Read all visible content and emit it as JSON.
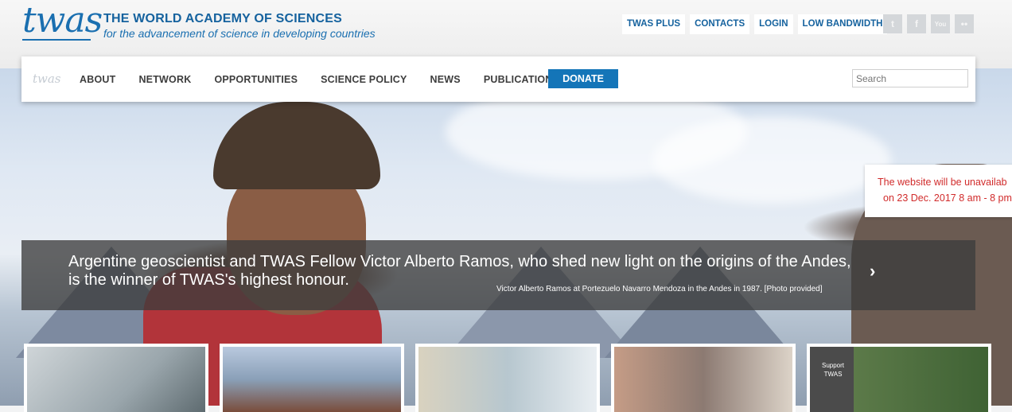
{
  "header": {
    "logo_text": "twas",
    "org_title": "THE WORLD ACADEMY OF SCIENCES",
    "org_subtitle": "for the advancement of science in developing countries",
    "top_links": [
      "TWAS PLUS",
      "CONTACTS",
      "LOGIN",
      "LOW BANDWIDTH"
    ],
    "social_icons": [
      "twitter-icon",
      "facebook-icon",
      "youtube-icon",
      "flickr-icon"
    ],
    "social_glyphs": [
      "t",
      "f",
      "You",
      "••"
    ]
  },
  "nav": {
    "logo_text": "twas",
    "items": [
      "ABOUT",
      "NETWORK",
      "OPPORTUNITIES",
      "SCIENCE POLICY",
      "NEWS",
      "PUBLICATIONS"
    ],
    "donate_label": "DONATE",
    "search_placeholder": "Search"
  },
  "notice": {
    "line1": "The website will be unavailab",
    "line2": "on 23 Dec. 2017 8 am - 8 pm",
    "color": "#d12b2b"
  },
  "hero": {
    "headline": "Argentine geoscientist and TWAS Fellow Victor Alberto Ramos, who shed new light on the origins of the Andes, is the winner of TWAS's highest honour.",
    "credit": "Victor Alberto Ramos at Portezuelo Navarro Mendoza in the Andes in 1987. [Photo provided]",
    "next_icon": "chevron-right-icon"
  },
  "thumbnails": [
    {
      "name": "lab-scientist-thumbnail"
    },
    {
      "name": "ramos-thumbnail"
    },
    {
      "name": "lab-researcher-thumbnail"
    },
    {
      "name": "women-group-thumbnail"
    },
    {
      "name": "support-twas-thumbnail",
      "label": "Support TWAS"
    }
  ],
  "colors": {
    "brand": "#1a6fb0",
    "donate": "#1475b8"
  }
}
